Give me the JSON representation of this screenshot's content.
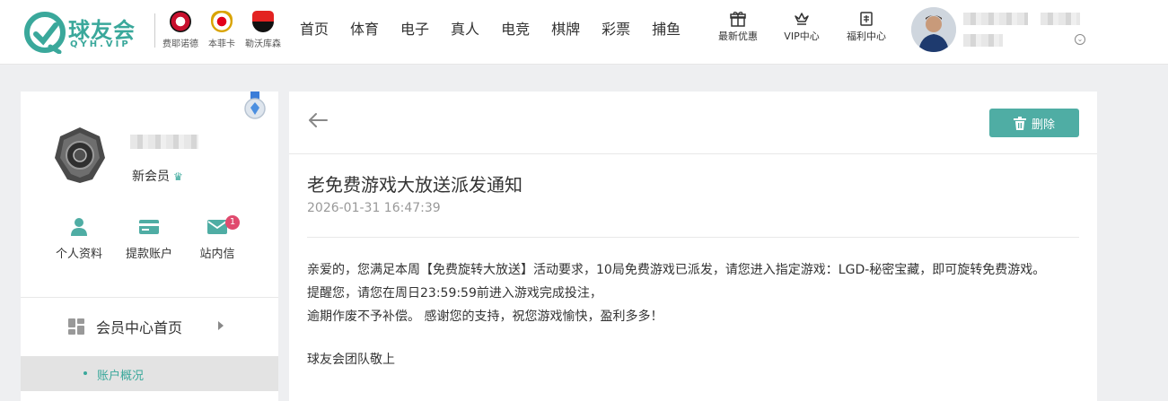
{
  "brand": {
    "name": "球友会",
    "domain": "QYH.VIP",
    "accent": "#3aa89b"
  },
  "partners": [
    {
      "name": "费耶诺德",
      "color": "#c8102e"
    },
    {
      "name": "本菲卡",
      "color": "#e2001a"
    },
    {
      "name": "勒沃库森",
      "color": "#e32221"
    }
  ],
  "nav": {
    "items": [
      "首页",
      "体育",
      "电子",
      "真人",
      "电竞",
      "棋牌",
      "彩票",
      "捕鱼"
    ],
    "icon_items": [
      {
        "label": "最新优惠",
        "icon": "gift-icon"
      },
      {
        "label": "VIP中心",
        "icon": "crown-icon"
      },
      {
        "label": "福利中心",
        "icon": "welfare-icon"
      }
    ]
  },
  "sidebar": {
    "member_level": "新会员",
    "quick_links": [
      {
        "label": "个人资料",
        "icon": "user-icon"
      },
      {
        "label": "提款账户",
        "icon": "card-icon"
      },
      {
        "label": "站内信",
        "icon": "mail-icon",
        "badge": "1"
      }
    ],
    "menu_home": "会员中心首页",
    "submenu_active": "账户概况"
  },
  "message": {
    "delete_label": "删除",
    "title": "老免费游戏大放送派发通知",
    "time": "2026-01-31 16:47:39",
    "body_lines": [
      "亲爱的，您满足本周【免费旋转大放送】活动要求，10局免费游戏已派发，请您进入指定游戏：LGD-秘密宝藏，即可旋转免费游戏。",
      "提醒您，请您在周日23:59:59前进入游戏完成投注，",
      "逾期作废不予补偿。 感谢您的支持，祝您游戏愉快，盈利多多！"
    ],
    "signature": "球友会团队敬上"
  }
}
